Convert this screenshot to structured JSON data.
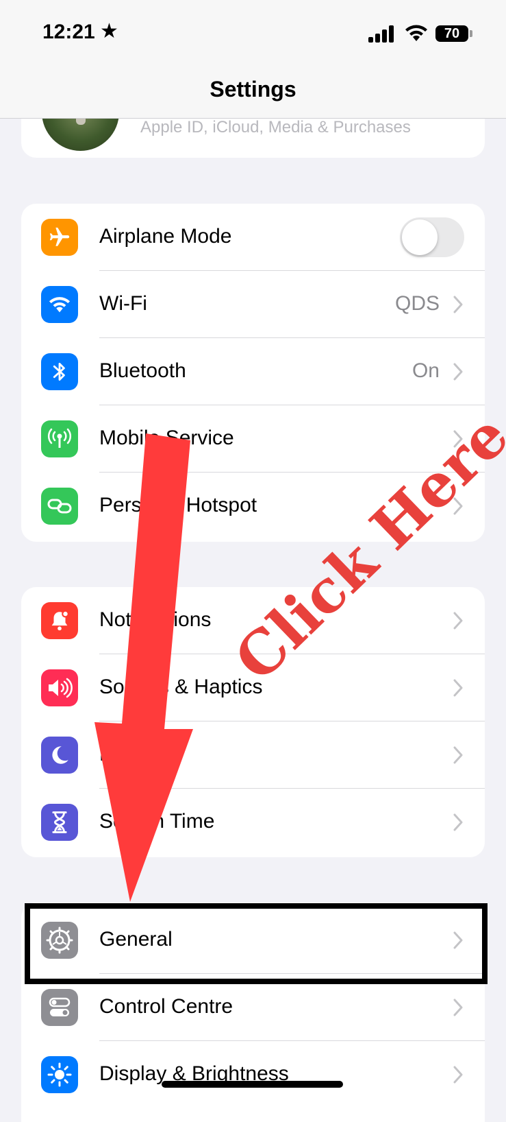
{
  "status_bar": {
    "time": "12:21",
    "time_icon": "star-icon",
    "battery": "70",
    "icons": [
      "cellular-signal-icon",
      "wifi-icon",
      "battery-icon"
    ]
  },
  "nav": {
    "title": "Settings"
  },
  "profile": {
    "subtitle": "Apple ID, iCloud, Media & Purchases"
  },
  "group1": [
    {
      "label": "Airplane Mode",
      "icon": "airplane-icon",
      "color": "#ff9500",
      "toggle": false
    },
    {
      "label": "Wi-Fi",
      "icon": "wifi-icon",
      "color": "#007aff",
      "value": "QDS"
    },
    {
      "label": "Bluetooth",
      "icon": "bluetooth-icon",
      "color": "#007aff",
      "value": "On"
    },
    {
      "label": "Mobile Service",
      "icon": "antenna-icon",
      "color": "#34c759"
    },
    {
      "label": "Personal Hotspot",
      "icon": "hotspot-link-icon",
      "color": "#34c759"
    }
  ],
  "group2": [
    {
      "label": "Notifications",
      "icon": "bell-icon",
      "color": "#ff3b30"
    },
    {
      "label": "Sounds & Haptics",
      "icon": "speaker-icon",
      "color": "#ff2d55"
    },
    {
      "label": "Focus",
      "icon": "moon-icon",
      "color": "#5856d6"
    },
    {
      "label": "Screen Time",
      "icon": "hourglass-icon",
      "color": "#5856d6"
    }
  ],
  "group3": [
    {
      "label": "General",
      "icon": "gear-icon",
      "color": "#8e8e93"
    },
    {
      "label": "Control Centre",
      "icon": "toggles-icon",
      "color": "#8e8e93"
    },
    {
      "label": "Display & Brightness",
      "icon": "sun-icon",
      "color": "#007aff"
    }
  ],
  "annotation": {
    "text": "Click Here",
    "color": "#e8413c"
  }
}
